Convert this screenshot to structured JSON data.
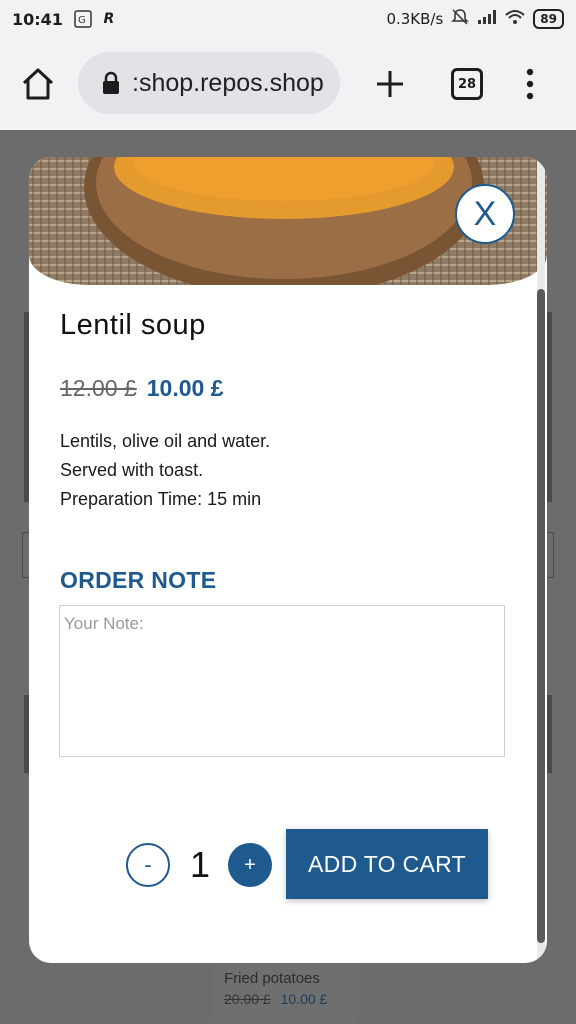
{
  "status_bar": {
    "time": "10:41",
    "net_speed": "0.3KB/s",
    "battery": "89",
    "icons": [
      "translate-icon",
      "r-app-icon",
      "muted-bell-icon",
      "signal-icon",
      "wifi-icon",
      "battery-icon"
    ]
  },
  "browser": {
    "url": ":shop.repos.shop",
    "tab_count": "28",
    "icons": [
      "home-icon",
      "lock-icon",
      "plus-icon",
      "tabs-icon",
      "more-vert-icon"
    ]
  },
  "background_card": {
    "name": "Fried potatoes",
    "old_price": "20.00 £",
    "new_price": "10.00 £"
  },
  "modal": {
    "close_label": "X",
    "title": "Lentil soup",
    "old_price": "12.00 £",
    "new_price": "10.00 £",
    "description": {
      "line1": "Lentils, olive oil and water.",
      "line2": "Served with toast.",
      "line3": "Preparation Time: 15 min"
    },
    "note_heading": "ORDER NOTE",
    "note_placeholder": "Your Note:",
    "note_value": "",
    "quantity": "1",
    "minus_label": "-",
    "plus_label": "+",
    "add_to_cart_label": "ADD TO CART"
  },
  "colors": {
    "accent": "#1f5a8e",
    "overlay": "#6c6c6c",
    "soup": "#e59a2d"
  }
}
